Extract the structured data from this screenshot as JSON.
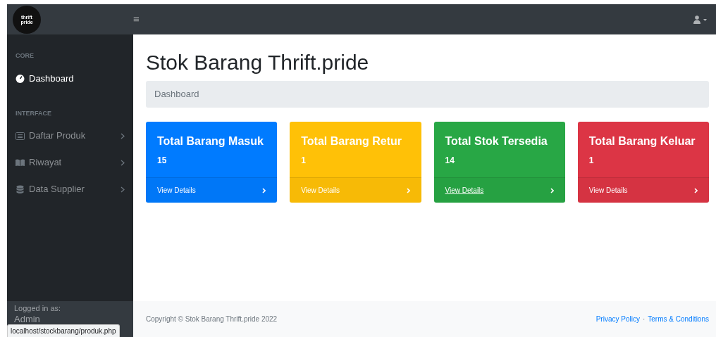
{
  "logo": {
    "lines": [
      "thrift",
      "pride"
    ]
  },
  "topbar": {
    "menu_glyph": "≡"
  },
  "sidebar": {
    "sections": [
      {
        "heading": "CORE",
        "items": [
          {
            "label": "Dashboard",
            "selected": true,
            "expandable": false
          }
        ]
      },
      {
        "heading": "INTERFACE",
        "items": [
          {
            "label": "Daftar Produk",
            "selected": false,
            "expandable": true
          },
          {
            "label": "Riwayat",
            "selected": false,
            "expandable": true
          },
          {
            "label": "Data Supplier",
            "selected": false,
            "expandable": true
          }
        ]
      }
    ],
    "footer": {
      "caption": "Logged in as:",
      "user": "Admin"
    }
  },
  "page": {
    "title": "Stok Barang Thrift.pride",
    "breadcrumb": "Dashboard"
  },
  "cards": [
    {
      "title": "Total Barang Masuk",
      "value": "15",
      "color": "#007bff",
      "link": "View Details",
      "hovered": false
    },
    {
      "title": "Total Barang Retur",
      "value": "1",
      "color": "#ffc107",
      "link": "View Details",
      "hovered": false
    },
    {
      "title": "Total Stok Tersedia",
      "value": "14",
      "color": "#28a745",
      "link": "View Details",
      "hovered": true
    },
    {
      "title": "Total Barang Keluar",
      "value": "1",
      "color": "#dc3545",
      "link": "View Details",
      "hovered": false
    }
  ],
  "footer": {
    "copyright": "Copyright © Stok Barang Thrift.pride 2022",
    "links": [
      "Privacy Policy",
      "Terms & Conditions"
    ],
    "separator": "·"
  },
  "status_url": "localhost/stockbarang/produk.php"
}
